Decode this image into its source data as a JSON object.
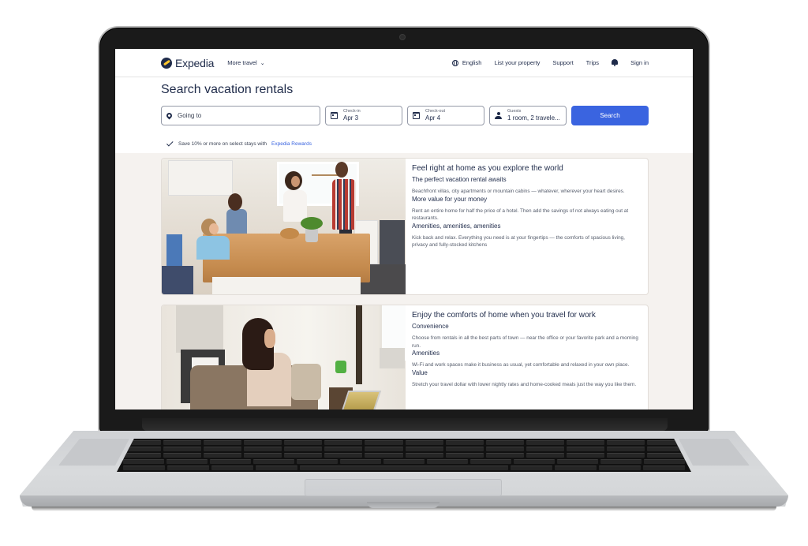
{
  "header": {
    "brand": "Expedia",
    "more_travel": "More travel",
    "nav": {
      "language": "English",
      "list_property": "List your property",
      "support": "Support",
      "trips": "Trips",
      "sign_in": "Sign in"
    }
  },
  "search": {
    "title": "Search vacation rentals",
    "destination_placeholder": "Going to",
    "check_in": {
      "label": "Check-in",
      "value": "Apr 3"
    },
    "check_out": {
      "label": "Check-out",
      "value": "Apr 4"
    },
    "guests": {
      "label": "Guests",
      "value": "1 room, 2 travele..."
    },
    "button": "Search"
  },
  "rewards": {
    "text": "Save 10% or more on select stays with",
    "link": "Expedia Rewards"
  },
  "cards": [
    {
      "title": "Feel right at home as you explore the world",
      "sections": [
        {
          "heading": "The perfect vacation rental awaits",
          "text": "Beachfront villas, city apartments or mountain cabins — whatever, wherever your heart desires."
        },
        {
          "heading": "More value for your money",
          "text": "Rent an entire home for half the price of a hotel. Then add the savings of not always eating out at restaurants."
        },
        {
          "heading": "Amenities, amenities, amenities",
          "text": "Kick back and relax. Everything you need is at your fingertips — the comforts of spacious living, privacy and fully-stocked kitchens"
        }
      ],
      "image": "family-in-kitchen-photo"
    },
    {
      "title": "Enjoy the comforts of home when you travel for work",
      "sections": [
        {
          "heading": "Convenience",
          "text": "Choose from rentals in all the best parts of town — near the office or your favorite park and a morning run."
        },
        {
          "heading": "Amenities",
          "text": "Wi-Fi and work spaces make it business as usual, yet comfortable and relaxed in your own place."
        },
        {
          "heading": "Value",
          "text": "Stretch your travel dollar with lower nightly rates and home-cooked meals just the way you like them."
        }
      ],
      "image": "woman-on-sofa-with-laptop-photo"
    }
  ],
  "colors": {
    "brand_navy": "#1f2b4a",
    "accent_blue": "#3a64e0",
    "brand_yellow": "#ffc72c"
  }
}
